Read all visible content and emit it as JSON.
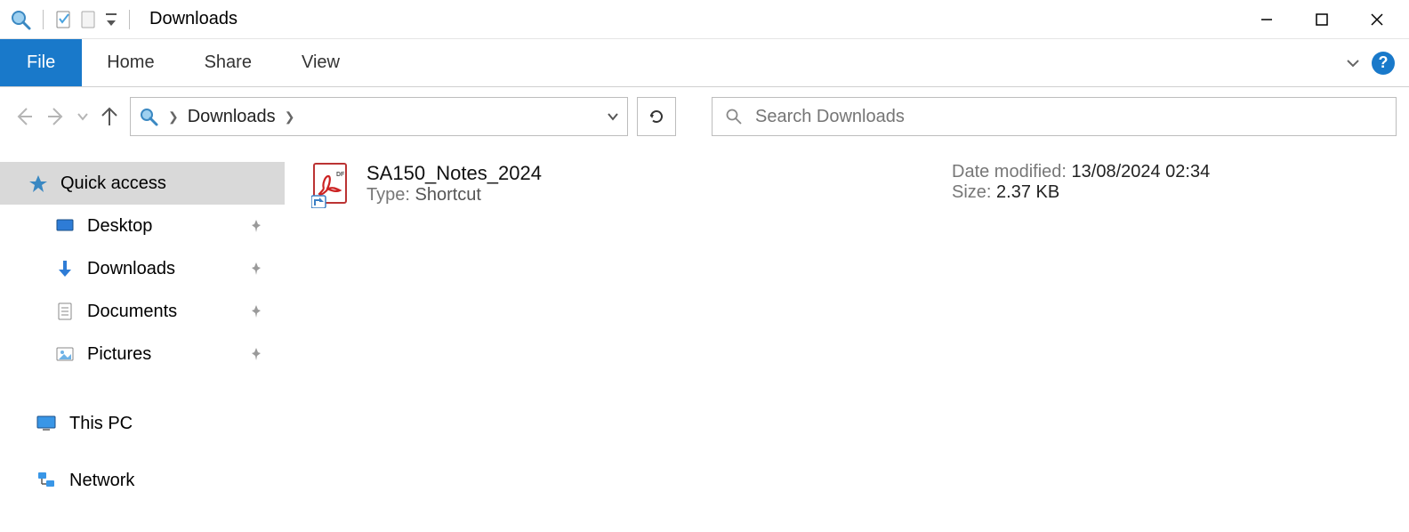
{
  "window": {
    "title": "Downloads"
  },
  "ribbon": {
    "file": "File",
    "tabs": [
      "Home",
      "Share",
      "View"
    ]
  },
  "nav": {
    "breadcrumb": "Downloads",
    "search_placeholder": "Search Downloads"
  },
  "sidebar": {
    "quick_access": "Quick access",
    "items": [
      {
        "label": "Desktop"
      },
      {
        "label": "Downloads"
      },
      {
        "label": "Documents"
      },
      {
        "label": "Pictures"
      }
    ],
    "this_pc": "This PC",
    "network": "Network"
  },
  "file": {
    "name": "SA150_Notes_2024",
    "type_label": "Type:",
    "type_value": "Shortcut",
    "mod_label": "Date modified:",
    "mod_value": "13/08/2024 02:34",
    "size_label": "Size:",
    "size_value": "2.37 KB"
  }
}
